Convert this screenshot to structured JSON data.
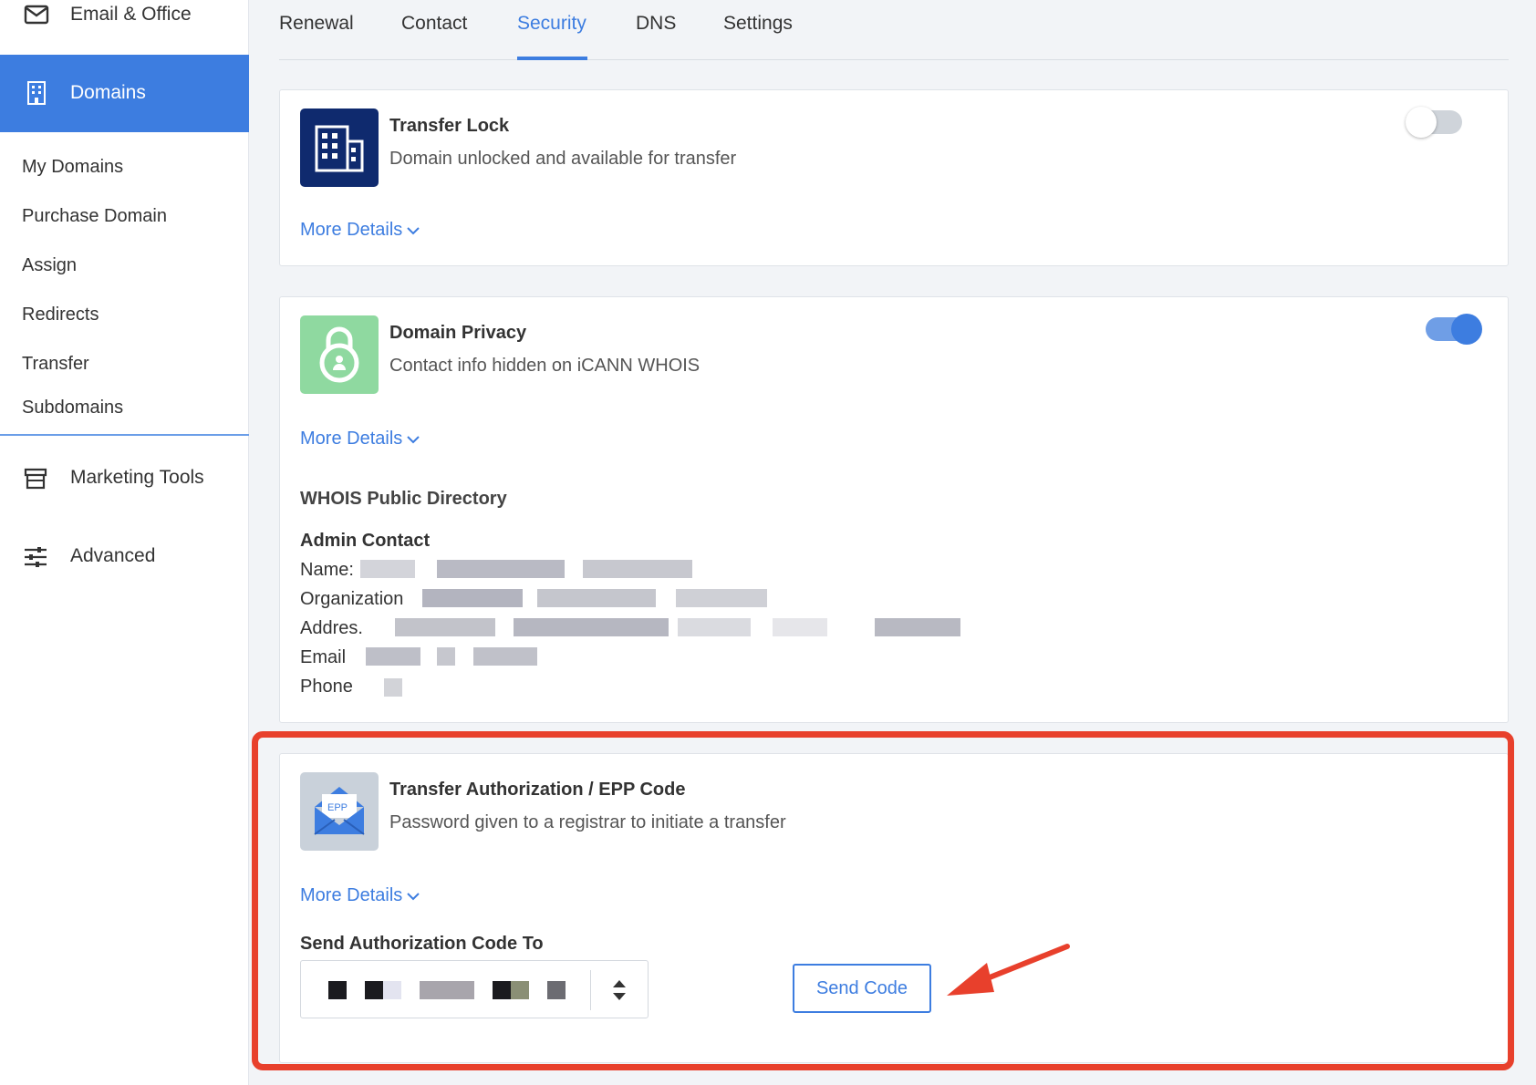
{
  "sidebar": {
    "top_item": {
      "label": "Email & Office",
      "icon": "mail-icon"
    },
    "active_item": {
      "label": "Domains",
      "icon": "building-icon"
    },
    "sub_items": [
      "My Domains",
      "Purchase Domain",
      "Assign",
      "Redirects",
      "Transfer",
      "Subdomains"
    ],
    "sections": [
      {
        "label": "Marketing Tools",
        "icon": "storefront-icon"
      },
      {
        "label": "Advanced",
        "icon": "sliders-icon"
      }
    ]
  },
  "tabs": {
    "items": [
      "Renewal",
      "Contact",
      "Security",
      "DNS",
      "Settings"
    ],
    "active": "Security"
  },
  "transfer_lock": {
    "title": "Transfer Lock",
    "subtitle": "Domain unlocked and available for transfer",
    "more": "More Details",
    "toggle_on": false,
    "icon": "building-icon"
  },
  "privacy": {
    "title": "Domain Privacy",
    "subtitle": "Contact info hidden on iCANN WHOIS",
    "more": "More Details",
    "toggle_on": true,
    "icon": "lock-icon",
    "whois_heading": "WHOIS Public Directory",
    "admin_heading": "Admin Contact",
    "fields": [
      "Name:",
      "Organization",
      "Addres.",
      "Email",
      "Phone"
    ]
  },
  "epp": {
    "title": "Transfer Authorization / EPP Code",
    "subtitle": "Password given to a registrar to initiate a transfer",
    "more": "More Details",
    "icon": "envelope-epp-icon",
    "icon_text": "EPP",
    "field_label": "Send Authorization Code To",
    "send_button": "Send Code"
  },
  "colors": {
    "accent": "#3d7de0",
    "lock_icon_bg": "#0f2a6e",
    "privacy_icon_bg": "#8fd9a0",
    "epp_icon_bg": "#c9d1da",
    "annotation": "#e8402c"
  }
}
